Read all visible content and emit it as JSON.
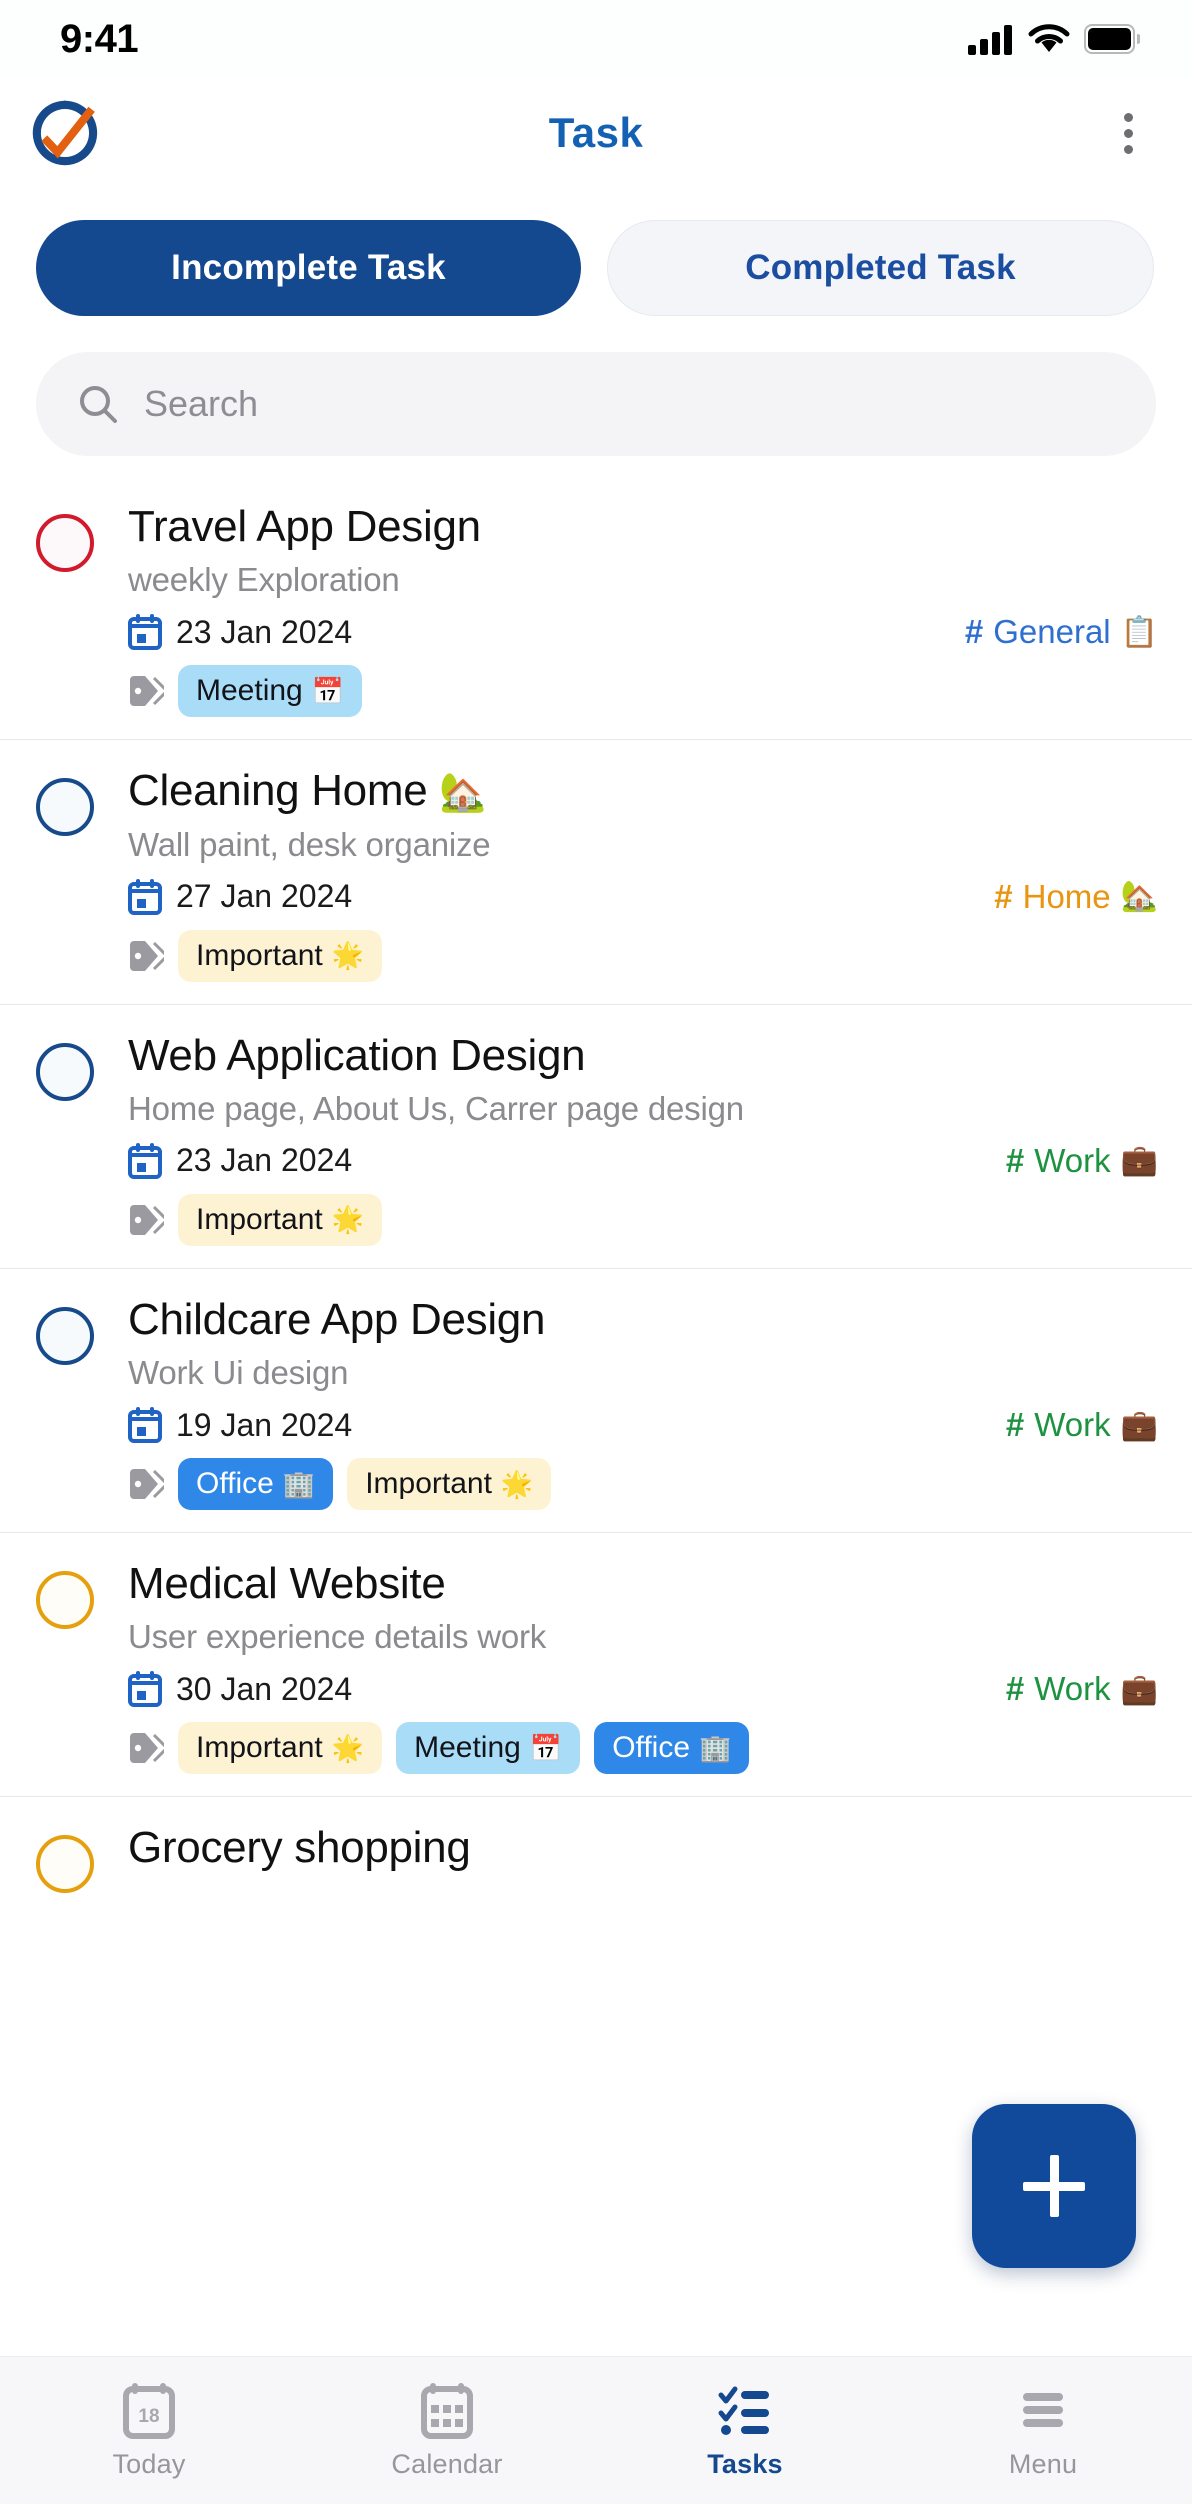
{
  "status_bar": {
    "time": "9:41"
  },
  "header": {
    "title": "Task",
    "logo_name": "app-logo",
    "menu_name": "overflow-menu"
  },
  "tabs": [
    {
      "label": "Incomplete Task",
      "active": true
    },
    {
      "label": "Completed Task",
      "active": false
    }
  ],
  "search": {
    "placeholder": "Search",
    "value": ""
  },
  "tasks": [
    {
      "title": "Travel App Design",
      "title_emoji": "",
      "subtitle": "weekly Exploration",
      "date": "23 Jan 2024",
      "circle_color": "red",
      "category": {
        "hash": "#",
        "label": "General",
        "emoji": "📋",
        "color": "blue"
      },
      "tags": [
        {
          "label": "Meeting",
          "emoji": "📅",
          "style": "meeting"
        }
      ]
    },
    {
      "title": "Cleaning Home",
      "title_emoji": "🏡",
      "subtitle": "Wall paint, desk organize",
      "date": "27 Jan 2024",
      "circle_color": "navy",
      "category": {
        "hash": "#",
        "label": "Home",
        "emoji": "🏡",
        "color": "orange"
      },
      "tags": [
        {
          "label": "Important",
          "emoji": "🌟",
          "style": "important"
        }
      ]
    },
    {
      "title": "Web Application Design",
      "title_emoji": "",
      "subtitle": "Home page, About Us, Carrer page design",
      "date": "23 Jan 2024",
      "circle_color": "navy",
      "category": {
        "hash": "#",
        "label": "Work",
        "emoji": "💼",
        "color": "green"
      },
      "tags": [
        {
          "label": "Important",
          "emoji": "🌟",
          "style": "important"
        }
      ]
    },
    {
      "title": "Childcare App Design",
      "title_emoji": "",
      "subtitle": "Work Ui design",
      "date": "19 Jan 2024",
      "circle_color": "navy",
      "category": {
        "hash": "#",
        "label": "Work",
        "emoji": "💼",
        "color": "green"
      },
      "tags": [
        {
          "label": "Office",
          "emoji": "🏢",
          "style": "office"
        },
        {
          "label": "Important",
          "emoji": "🌟",
          "style": "important"
        }
      ]
    },
    {
      "title": "Medical Website",
      "title_emoji": "",
      "subtitle": "User experience details work",
      "date": "30 Jan 2024",
      "circle_color": "amber",
      "category": {
        "hash": "#",
        "label": "Work",
        "emoji": "💼",
        "color": "green"
      },
      "tags": [
        {
          "label": "Important",
          "emoji": "🌟",
          "style": "important"
        },
        {
          "label": "Meeting",
          "emoji": "📅",
          "style": "meeting"
        },
        {
          "label": "Office",
          "emoji": "🏢",
          "style": "office"
        }
      ]
    },
    {
      "title": "Grocery shopping",
      "title_emoji": "",
      "subtitle": "",
      "date": "",
      "circle_color": "amber",
      "category": null,
      "tags": []
    }
  ],
  "fab": {
    "label": "+",
    "name": "add-task-button"
  },
  "bottom_nav": [
    {
      "label": "Today",
      "icon": "calendar-day-icon",
      "active": false
    },
    {
      "label": "Calendar",
      "icon": "calendar-grid-icon",
      "active": false
    },
    {
      "label": "Tasks",
      "icon": "checklist-icon",
      "active": true
    },
    {
      "label": "Menu",
      "icon": "hamburger-icon",
      "active": false
    }
  ],
  "colors": {
    "primary": "#14498f",
    "accent_orange": "#e2600f",
    "category_blue": "#2f6fd0",
    "category_orange": "#e99512",
    "category_green": "#1f9241",
    "circle_red": "#d11a2a",
    "circle_amber": "#e5a010",
    "circle_navy": "#174a8b",
    "chip_meeting_bg": "#a9ddf7",
    "chip_important_bg": "#fdf3d3",
    "chip_office_bg": "#2f88e8"
  },
  "nav_day_number": "18"
}
